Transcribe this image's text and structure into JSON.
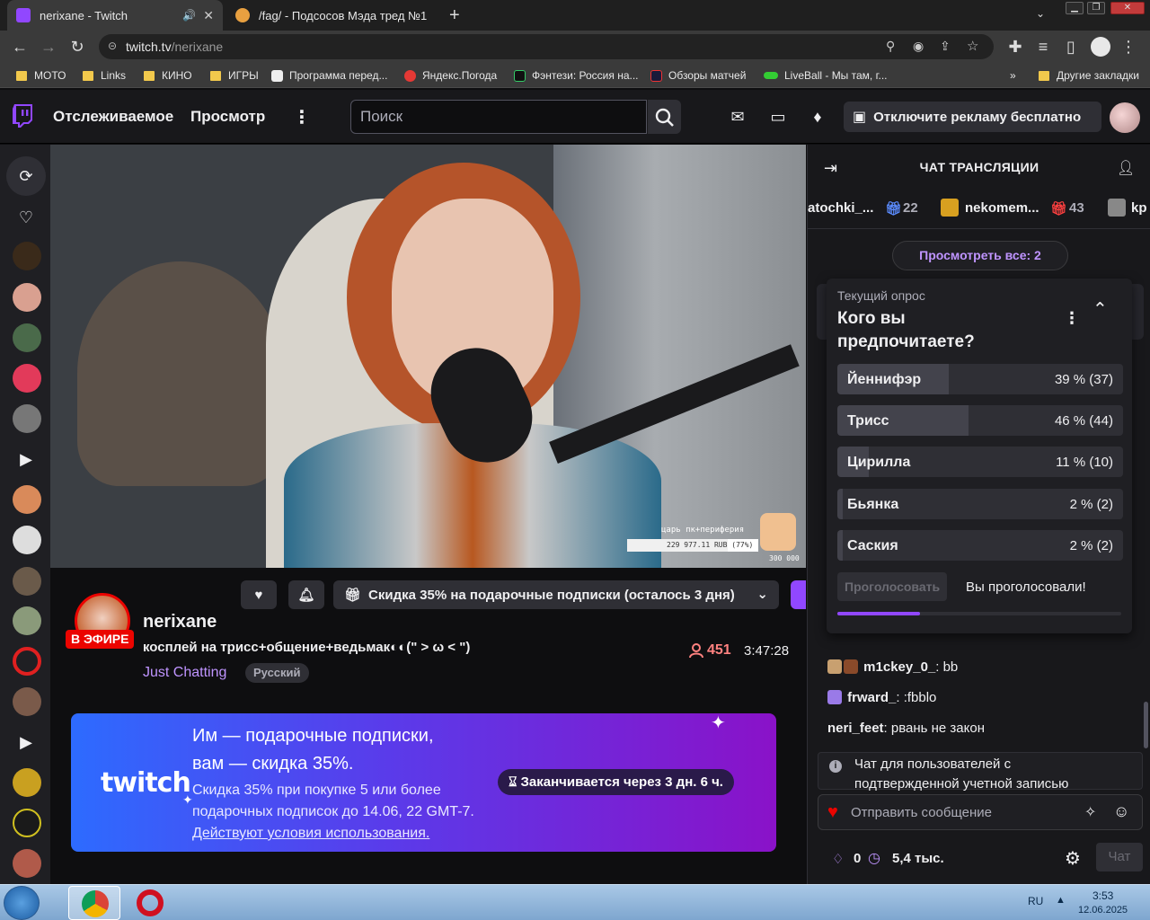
{
  "browser": {
    "tabs": [
      {
        "title": "nerixane - Twitch",
        "active": true
      },
      {
        "title": "/fag/ - Подсосов Мэда тред №1",
        "active": false
      }
    ],
    "new_tab": "+",
    "url_host": "twitch.tv",
    "url_path": "/nerixane",
    "bookmarks": [
      "МОТО",
      "Links",
      "КИНО",
      "ИГРЫ",
      "Программа перед...",
      "Яндекс.Погода",
      "Фэнтези: Россия на...",
      "Обзоры матчей",
      "LiveBall - Мы там, г..."
    ],
    "bookmarks_more": "»",
    "bookmarks_other": "Другие закладки"
  },
  "topnav": {
    "following": "Отслеживаемое",
    "browse": "Просмотр",
    "search_placeholder": "Поиск",
    "adfree": "Отключите рекламу бесплатно"
  },
  "video": {
    "overlay_label": "царь пк+периферия",
    "overlay_amount": "229 977.11 RUB (77%)",
    "overlay_goal": "300 000",
    "goal_progress": 0.77
  },
  "channel": {
    "live_badge": "В ЭФИРЕ",
    "name": "nerixane",
    "title": "косплей на трисс+общение+ведьмак◐◐(\" > ω < \")",
    "category": "Just Chatting",
    "tag": "Русский",
    "gift_sub_button": "Скидка 35% на подарочные подписки (осталось 3 дня)",
    "viewers": "451",
    "uptime": "3:47:28"
  },
  "promo": {
    "logo": "twitch",
    "headline1": "Им — подарочные подписки,",
    "headline2": "вам — скидка 35%.",
    "body": "Скидка 35% при покупке 5 или более подарочных подписок до 14.06, 22 GMT-7.",
    "link": "Действуют условия использования.",
    "timer": "Заканчивается через 3 дн. 6 ч."
  },
  "chat": {
    "header": "ЧАТ ТРАНСЛЯЦИИ",
    "gifters": [
      {
        "name": "atochki_...",
        "count": "22"
      },
      {
        "name": "nekomem...",
        "count": "43"
      },
      {
        "name": "kp",
        "count": ""
      }
    ],
    "view_all": "Просмотреть все: 2",
    "poll": {
      "label": "Текущий опрос",
      "question": "Кого вы предпочитаете?",
      "options": [
        {
          "name": "Йеннифэр",
          "result": "39 % (37)",
          "fraction": 0.39
        },
        {
          "name": "Трисс",
          "result": "46 % (44)",
          "fraction": 0.46
        },
        {
          "name": "Цирилла",
          "result": "11 % (10)",
          "fraction": 0.11
        },
        {
          "name": "Бьянка",
          "result": "2 % (2)",
          "fraction": 0.02
        },
        {
          "name": "Саския",
          "result": "2 % (2)",
          "fraction": 0.02
        }
      ],
      "vote_button": "Проголосовать",
      "voted_text": "Вы проголосовали!",
      "time_progress": 0.29
    },
    "messages": [
      {
        "user": "m1ckey_0_",
        "text": ": bb",
        "color": "#00e676"
      },
      {
        "user": "frward_",
        "text": ": :fbblo",
        "color": "#7fd0c0"
      },
      {
        "user": "neri_feet",
        "text": ": рвань не закон",
        "color": "#f0c020"
      }
    ],
    "notice": "Чат для пользователей с подтвержденной учетной записью",
    "input_placeholder": "Отправить сообщение",
    "points": "0",
    "points_extra": "5,4 тыс.",
    "chat_button": "Чат"
  },
  "taskbar": {
    "lang": "RU",
    "time": "3:53",
    "date": "12.06.2025"
  },
  "colors": {
    "twitch_purple": "#9147ff",
    "live_red": "#eb0400",
    "accent_text": "#bf94ff"
  }
}
